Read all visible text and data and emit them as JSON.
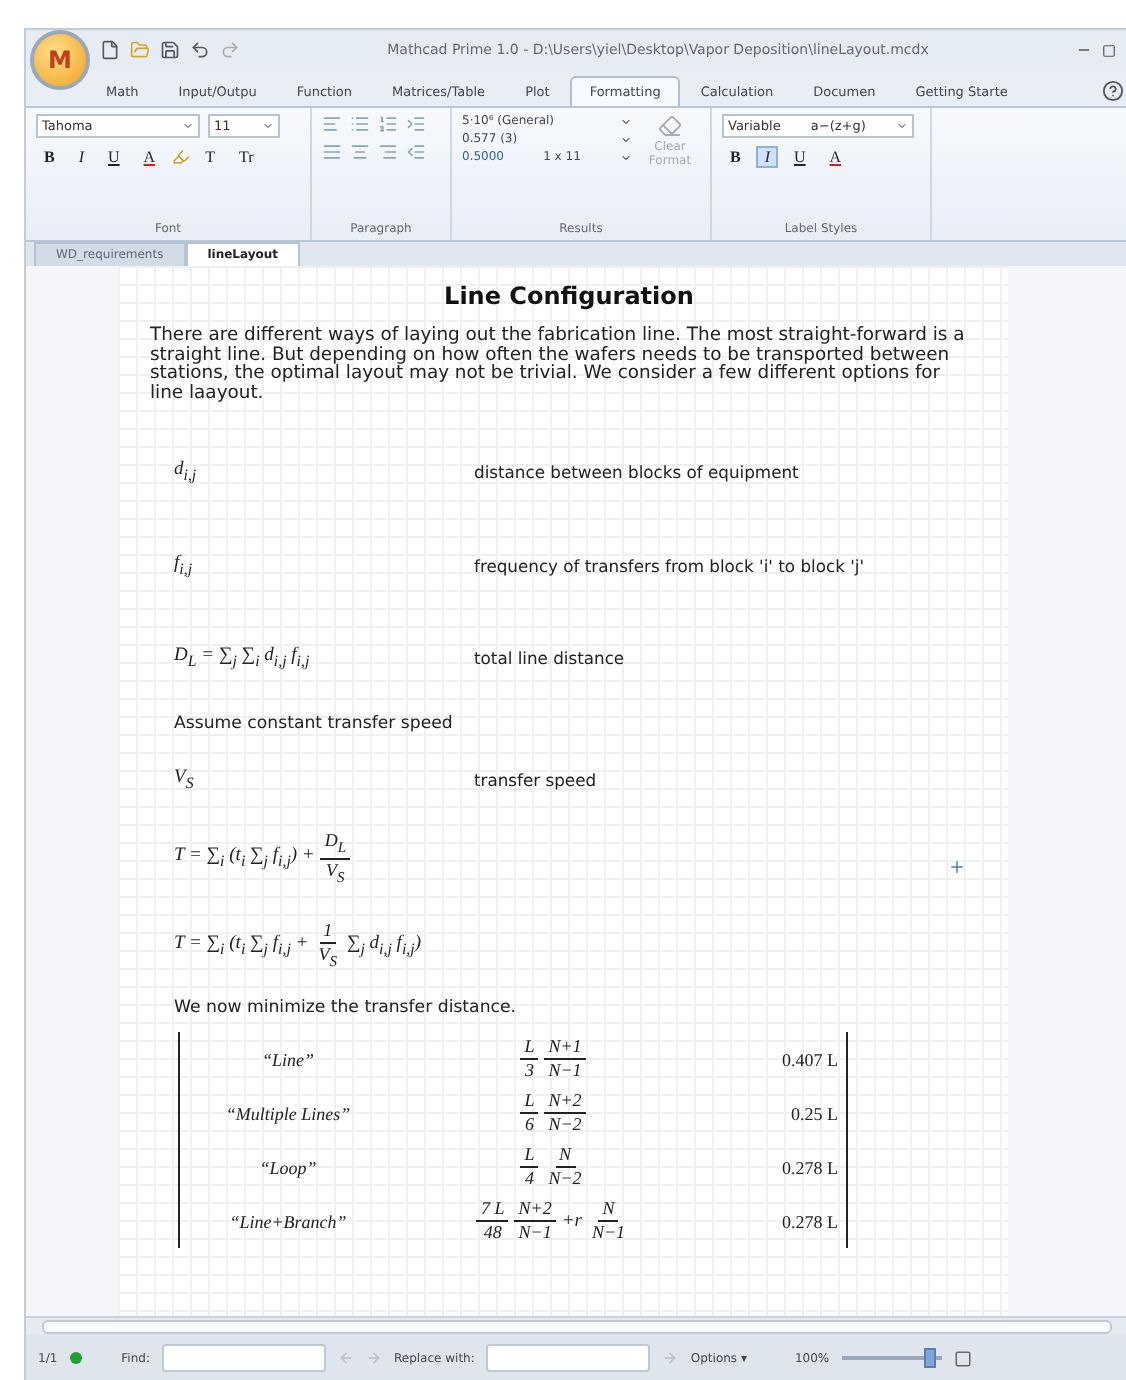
{
  "window": {
    "logo": "M",
    "title": "Mathcad Prime 1.0 - D:\\Users\\yiel\\Desktop\\Vapor Deposition\\lineLayout.mcdx"
  },
  "ribbon_tabs": [
    {
      "label": "Math",
      "selected": false
    },
    {
      "label": "Input/Outpu",
      "selected": false
    },
    {
      "label": "Function",
      "selected": false
    },
    {
      "label": "Matrices/Table",
      "selected": false
    },
    {
      "label": "Plot",
      "selected": false
    },
    {
      "label": "Formatting",
      "selected": true
    },
    {
      "label": "Calculation",
      "selected": false
    },
    {
      "label": "Documen",
      "selected": false
    },
    {
      "label": "Getting Starte",
      "selected": false
    }
  ],
  "font_group": {
    "label": "Font",
    "font": "Tahoma",
    "size": "11",
    "styles": [
      {
        "label": "B",
        "kind": "bold",
        "selected": false
      },
      {
        "label": "I",
        "kind": "italic",
        "selected": false
      },
      {
        "label": "U",
        "kind": "underline",
        "selected": false
      }
    ],
    "color_label": "A",
    "size_labels": [
      "T",
      "Tr"
    ]
  },
  "paragraph_group": {
    "label": "Paragraph"
  },
  "results_group": {
    "label": "Results",
    "format": "5·10⁶ (General)",
    "precision": "0.577 (3)",
    "sample": "0.5000",
    "matrix": "1 x 11",
    "clear_label": "Clear Format"
  },
  "label_styles_group": {
    "label": "Label Styles",
    "style": "Variable",
    "preview": "a−(z+g)",
    "styles": [
      {
        "label": "B",
        "kind": "bold",
        "selected": false
      },
      {
        "label": "I",
        "kind": "italic",
        "selected": true
      },
      {
        "label": "U",
        "kind": "underline",
        "selected": false
      }
    ],
    "color_label": "A"
  },
  "doc_tabs": [
    {
      "label": "WD_requirements",
      "selected": false
    },
    {
      "label": "lineLayout",
      "selected": true
    }
  ],
  "worksheet": {
    "title": "Line Configuration",
    "intro": "There are different ways of laying out the fabrication line.  The most straight-forward is a straight line.  But depending on how often the wafers needs to be transported between stations, the optimal layout may not be trivial.  We consider a few different options for line laayout.",
    "regions": [
      {
        "kind": "definition",
        "math": "d$_{i,j}$",
        "description": "distance between blocks of equipment"
      },
      {
        "kind": "definition",
        "math": "f$_{i,j}$",
        "description": "frequency of transfers from block 'i' to block 'j'"
      },
      {
        "kind": "definition",
        "math": "D$_{L}$ = ∑$_{j}$ ∑$_{i}$ d$_{i,j}$ f$_{i,j}$",
        "description": "total line distance"
      },
      {
        "kind": "text",
        "text": "Assume constant transfer speed"
      },
      {
        "kind": "definition",
        "math": "V$_{S}$",
        "description": "transfer speed"
      },
      {
        "kind": "formula",
        "parts": [
          {
            "kind": "term",
            "text": "T = ∑$_{i}$ (t$_{i}$ ∑$_{j}$ f$_{i,j}$) +"
          },
          {
            "kind": "fraction",
            "num": "D$_{L}$",
            "den": "V$_{S}$"
          }
        ]
      },
      {
        "kind": "formula",
        "parts": [
          {
            "kind": "term",
            "text": "T = ∑$_{i}$ (t$_{i}$ ∑$_{j}$ f$_{i,j}$ +"
          },
          {
            "kind": "fraction",
            "num": "1",
            "den": "V$_{S}$"
          },
          {
            "kind": "term",
            "text": "∑$_{j}$ d$_{i,j}$ f$_{i,j}$)"
          }
        ]
      },
      {
        "kind": "text",
        "text": "We now minimize the transfer distance."
      },
      {
        "kind": "matrix",
        "rows": [
          {
            "label": "“Line”",
            "parts": [
              {
                "kind": "fraction",
                "num": "L",
                "den": "3"
              },
              {
                "kind": "fraction",
                "num": "N+1",
                "den": "N−1"
              }
            ],
            "value": "0.407 L"
          },
          {
            "label": "“Multiple Lines”",
            "parts": [
              {
                "kind": "fraction",
                "num": "L",
                "den": "6"
              },
              {
                "kind": "fraction",
                "num": "N+2",
                "den": "N−2"
              }
            ],
            "value": "0.25 L"
          },
          {
            "label": "“Loop”",
            "parts": [
              {
                "kind": "fraction",
                "num": "L",
                "den": "4"
              },
              {
                "kind": "fraction",
                "num": "N",
                "den": "N−2"
              }
            ],
            "value": "0.278 L"
          },
          {
            "label": "“Line+Branch”",
            "parts": [
              {
                "kind": "fraction",
                "num": "7 L",
                "den": "48"
              },
              {
                "kind": "fraction",
                "num": "N+2",
                "den": "N−1"
              },
              {
                "kind": "term",
                "text": "+r"
              },
              {
                "kind": "fraction",
                "num": "N",
                "den": "N−1"
              }
            ],
            "value": "0.278 L"
          }
        ]
      }
    ]
  },
  "status_bar": {
    "page": "1/1",
    "find_label": "Find:",
    "replace_label": "Replace with:",
    "options": "Options",
    "options_caret": "▾",
    "zoom": "100%",
    "zoom_slider": {
      "level": 0.88
    }
  }
}
